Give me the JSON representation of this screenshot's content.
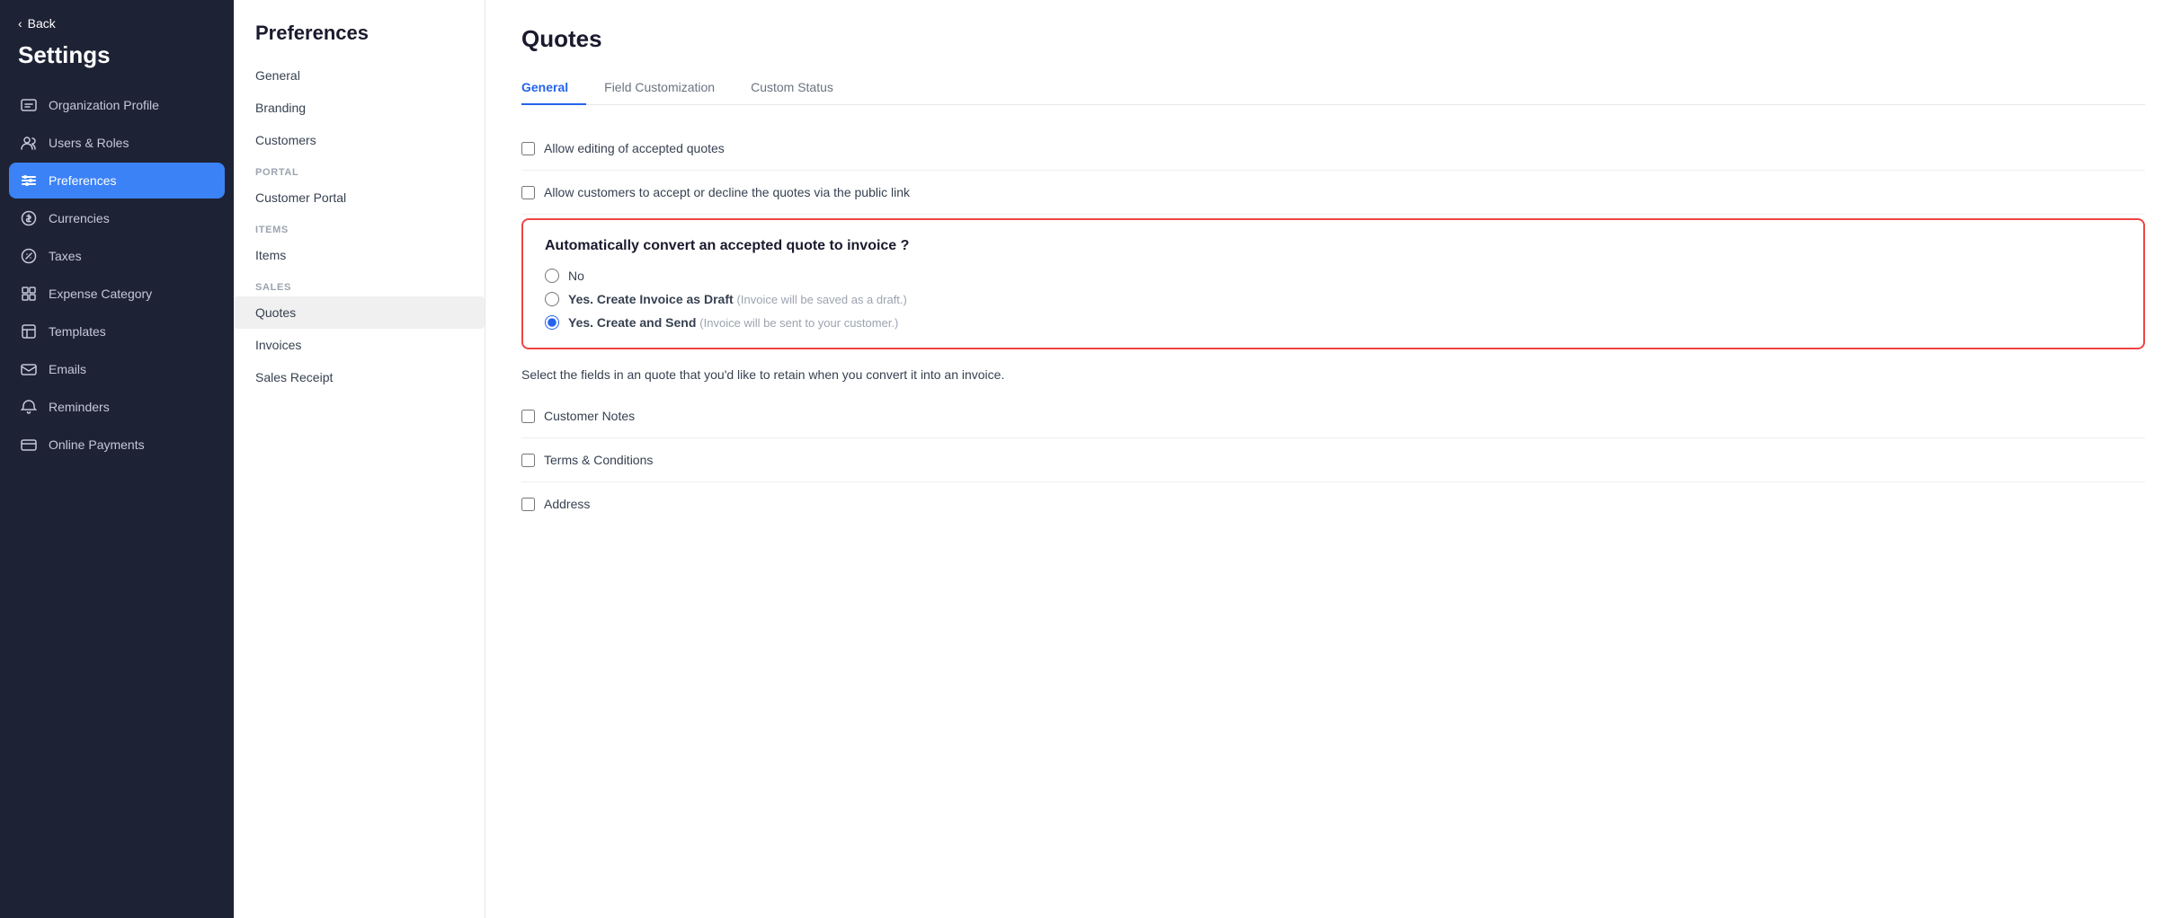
{
  "sidebar": {
    "back_label": "Back",
    "title": "Settings",
    "items": [
      {
        "id": "org-profile",
        "label": "Organization Profile",
        "icon": "org",
        "active": false
      },
      {
        "id": "users-roles",
        "label": "Users & Roles",
        "icon": "users",
        "active": false
      },
      {
        "id": "preferences",
        "label": "Preferences",
        "icon": "prefs",
        "active": true
      },
      {
        "id": "currencies",
        "label": "Currencies",
        "icon": "currencies",
        "active": false
      },
      {
        "id": "taxes",
        "label": "Taxes",
        "icon": "taxes",
        "active": false
      },
      {
        "id": "expense-category",
        "label": "Expense Category",
        "icon": "expense",
        "active": false
      },
      {
        "id": "templates",
        "label": "Templates",
        "icon": "templates",
        "active": false
      },
      {
        "id": "emails",
        "label": "Emails",
        "icon": "emails",
        "active": false
      },
      {
        "id": "reminders",
        "label": "Reminders",
        "icon": "reminders",
        "active": false
      },
      {
        "id": "online-payments",
        "label": "Online Payments",
        "icon": "payments",
        "active": false
      }
    ]
  },
  "middle_panel": {
    "title": "Preferences",
    "top_items": [
      {
        "id": "general",
        "label": "General",
        "active": false
      },
      {
        "id": "branding",
        "label": "Branding",
        "active": false
      },
      {
        "id": "customers",
        "label": "Customers",
        "active": false
      }
    ],
    "portal_label": "PORTAL",
    "portal_items": [
      {
        "id": "customer-portal",
        "label": "Customer Portal",
        "active": false
      }
    ],
    "items_label": "ITEMS",
    "items_items": [
      {
        "id": "items",
        "label": "Items",
        "active": false
      }
    ],
    "sales_label": "SALES",
    "sales_items": [
      {
        "id": "quotes",
        "label": "Quotes",
        "active": true
      },
      {
        "id": "invoices",
        "label": "Invoices",
        "active": false
      },
      {
        "id": "sales-receipt",
        "label": "Sales Receipt",
        "active": false
      }
    ]
  },
  "main": {
    "title": "Quotes",
    "tabs": [
      {
        "id": "general",
        "label": "General",
        "active": true
      },
      {
        "id": "field-customization",
        "label": "Field Customization",
        "active": false
      },
      {
        "id": "custom-status",
        "label": "Custom Status",
        "active": false
      }
    ],
    "allow_editing_label": "Allow editing of accepted quotes",
    "allow_customers_label": "Allow customers to accept or decline the quotes via the public link",
    "auto_convert_title": "Automatically convert an accepted quote to invoice ?",
    "radio_no": "No",
    "radio_draft": "Yes. Create Invoice as Draft",
    "radio_draft_hint": "(Invoice will be saved as a draft.)",
    "radio_send": "Yes. Create and Send",
    "radio_send_hint": "(Invoice will be sent to your customer.)",
    "retain_label": "Select the fields in an quote that you'd like to retain when you convert it into an invoice.",
    "customer_notes_label": "Customer Notes",
    "terms_label": "Terms & Conditions",
    "address_label": "Address"
  }
}
